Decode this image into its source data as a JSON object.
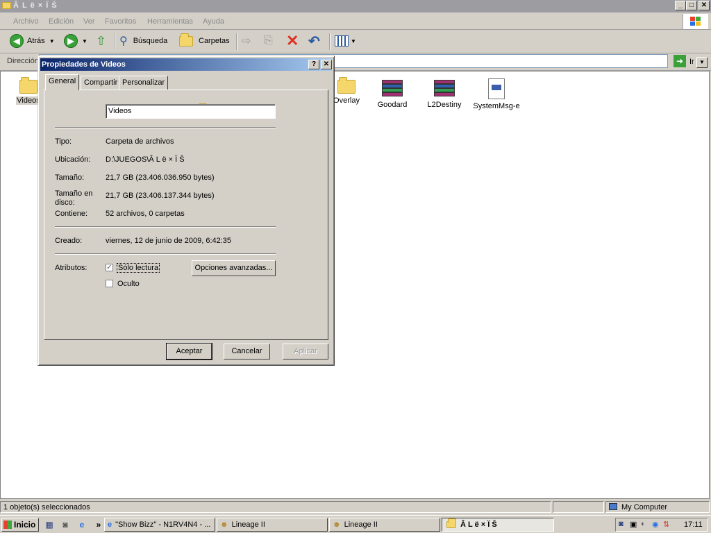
{
  "window": {
    "title": "Â L ë × Ï Š",
    "buttons": {
      "minimize": "_",
      "maximize": "□",
      "close": "✕"
    }
  },
  "menu": [
    "Archivo",
    "Edición",
    "Ver",
    "Favoritos",
    "Herramientas",
    "Ayuda"
  ],
  "toolbar": {
    "back_label": "Atrás",
    "search_label": "Búsqueda",
    "folders_label": "Carpetas"
  },
  "address": {
    "label": "Dirección",
    "go_label": "Ir"
  },
  "files": [
    {
      "name": "Videos",
      "icon": "folder-icon"
    },
    {
      "name": "Overlay",
      "icon": "folder-icon"
    },
    {
      "name": "Goodard",
      "icon": "winrar-icon"
    },
    {
      "name": "L2Destiny",
      "icon": "winrar-icon"
    },
    {
      "name": "SystemMsg-e",
      "icon": "document-icon"
    }
  ],
  "dialog": {
    "title": "Propiedades de Videos",
    "help_button": "?",
    "close_button": "✕",
    "tabs": [
      "General",
      "Compartir",
      "Personalizar"
    ],
    "name_value": "Videos",
    "fields": {
      "tipo_label": "Tipo:",
      "tipo_value": "Carpeta de archivos",
      "ubicacion_label": "Ubicación:",
      "ubicacion_value": "D:\\JUEGOS\\Â L ë × Ï Š",
      "tamano_label": "Tamaño:",
      "tamano_value": "21,7 GB (23.406.036.950 bytes)",
      "tamano_disco_label_1": "Tamaño en",
      "tamano_disco_label_2": "disco:",
      "tamano_disco_value": "21,7 GB (23.406.137.344 bytes)",
      "contiene_label": "Contiene:",
      "contiene_value": "52 archivos, 0 carpetas",
      "creado_label": "Creado:",
      "creado_value": "viernes, 12 de junio de 2009, 6:42:35",
      "atributos_label": "Atributos:"
    },
    "attributes": {
      "readonly_label": "Sólo lectura",
      "readonly_checked": true,
      "hidden_label": "Oculto",
      "hidden_checked": false,
      "advanced_button": "Opciones avanzadas..."
    },
    "buttons": {
      "ok": "Aceptar",
      "cancel": "Cancelar",
      "apply": "Aplicar"
    }
  },
  "statusbar": {
    "selection": "1 objeto(s) seleccionados",
    "location": "My Computer"
  },
  "taskbar": {
    "start": "Inicio",
    "tasks": [
      "\"Show Bizz\" - N1RV4N4 - ...",
      "Lineage II",
      "Lineage II",
      "Â L ë × Ï Š"
    ],
    "clock": "17:11"
  }
}
